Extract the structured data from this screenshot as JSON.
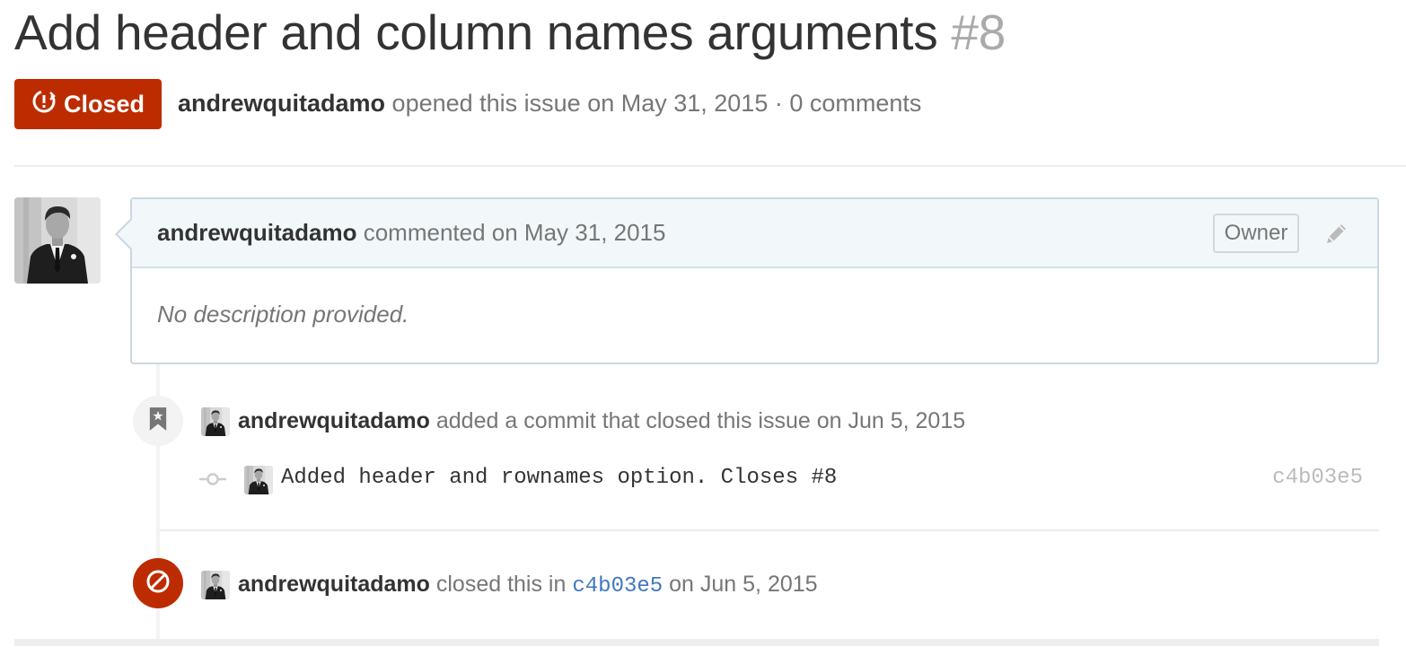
{
  "issue": {
    "title": "Add header and column names arguments",
    "number": "#8",
    "state_label": "Closed",
    "author": "andrewquitadamo",
    "meta_text": "opened this issue on May 31, 2015 · 0 comments"
  },
  "comment": {
    "author": "andrewquitadamo",
    "header_text": "commented on May 31, 2015",
    "owner_badge": "Owner",
    "body": "No description provided."
  },
  "events": {
    "commit_event": {
      "author": "andrewquitadamo",
      "text": "added a commit that closed this issue on Jun 5, 2015"
    },
    "commit": {
      "message": "Added header and rownames option. Closes #8",
      "sha": "c4b03e5"
    },
    "closed_event": {
      "author": "andrewquitadamo",
      "text_before": "closed this in",
      "sha_link": "c4b03e5",
      "text_after": "on Jun 5, 2015"
    }
  },
  "icons": {
    "state": "issue-closed-icon",
    "edit": "pencil-icon",
    "bookmark": "bookmark-icon",
    "commit": "git-commit-icon",
    "closed": "circle-slash-icon"
  },
  "colors": {
    "closed_red": "#bd2c00",
    "link_blue": "#4078c0",
    "comment_header_bg": "#f2f8fa",
    "comment_border": "#cad8e4"
  }
}
